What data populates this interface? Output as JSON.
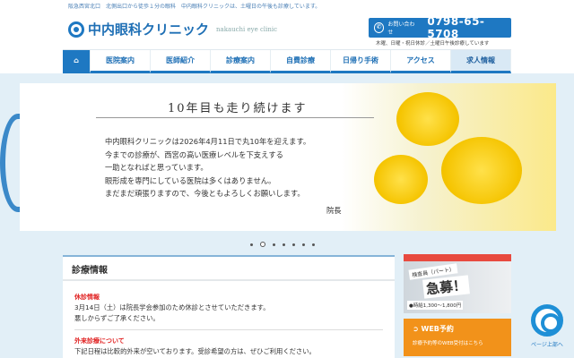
{
  "topbar": "阪急西宮北口　北側出口から徒歩１分の眼科　中内眼科クリニックは、土曜日の午後も診療しています。",
  "logo": {
    "name": "中内眼科クリニック",
    "sub": "nakauchi eye clinic"
  },
  "contact": {
    "label": "お問い合わせ",
    "phone": "0798-65-5708",
    "hours": "木曜、日曜・祝日休診／土曜日午後診療しています"
  },
  "nav": [
    "⌂",
    "医院案内",
    "医師紹介",
    "診療案内",
    "自費診療",
    "日帰り手術",
    "アクセス",
    "求人情報"
  ],
  "slide": {
    "title": "10年目も走り続けます",
    "lines": [
      "中内眼科クリニックは2026年4月11日で丸10年を迎えます。",
      "今までの診療が、西宮の高い医療レベルを下支えする",
      "一助となればと思っています。",
      "眼形成を専門にしている医院は多くはありません。",
      "まだまだ頑張りますので、今後ともよろしくお願いします。"
    ],
    "sign": "院長"
  },
  "slider": {
    "count": 7,
    "active": 1
  },
  "info": {
    "title": "診療情報",
    "blocks": [
      {
        "head": "休診情報",
        "lines": [
          "3月14日（土）は院長学会参加のため休診とさせていただきます。",
          "悪しからずご了承ください。"
        ]
      },
      {
        "head": "外来診療について",
        "lines": [
          "下記日程は比較的外来が空いております。受診希望の方は、ぜひご利用ください。"
        ]
      }
    ]
  },
  "recruit": {
    "tag": "検査員（パート）",
    "main": "急募！",
    "pay": "●時給1,300〜1,800円"
  },
  "web": {
    "title": "WEB予約",
    "sub": "診療予約等のWEB受付はこちら"
  },
  "pagetop": "ページ上部へ"
}
